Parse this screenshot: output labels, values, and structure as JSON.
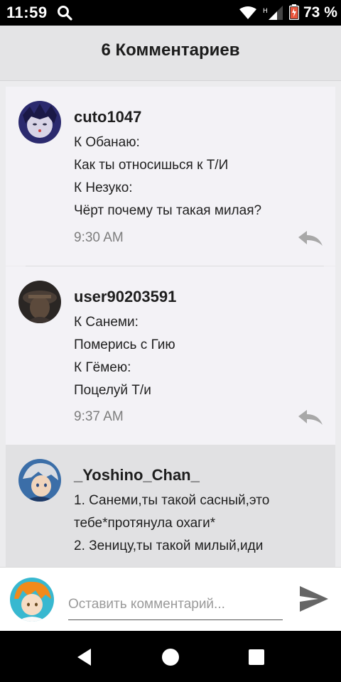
{
  "status_bar": {
    "time": "11:59",
    "network_type": "H",
    "battery_percent": "73 %",
    "icons": [
      "search-icon",
      "wifi-icon",
      "signal-icon",
      "battery-icon"
    ]
  },
  "header": {
    "title": "6 Комментариев"
  },
  "comments": [
    {
      "username": "cuto1047",
      "lines": [
        "К Обанаю:",
        "Как ты относишься к Т/И",
        "К Незуко:",
        "Чёрт почему ты такая милая?"
      ],
      "time": "9:30 AM",
      "highlighted": false
    },
    {
      "username": "user90203591",
      "lines": [
        "К Санеми:",
        "Померись с Гию",
        "К Гёмею:",
        "Поцелуй Т/и"
      ],
      "time": "9:37 AM",
      "highlighted": false
    },
    {
      "username": "_Yoshino_Chan_",
      "lines": [
        "1. Санеми,ты такой сасный,это",
        "тебе*протянула охаги*",
        "2. Зеницу,ты такой милый,иди"
      ],
      "time": "",
      "highlighted": true
    }
  ],
  "input": {
    "placeholder": "Оставить комментарий..."
  },
  "colors": {
    "header_bg": "#e4e4e6",
    "comment_bg": "#f3f2f6",
    "highlight_bg": "#e1e1e3",
    "reply_icon": "#a8a8a8",
    "send_icon": "#666666"
  }
}
